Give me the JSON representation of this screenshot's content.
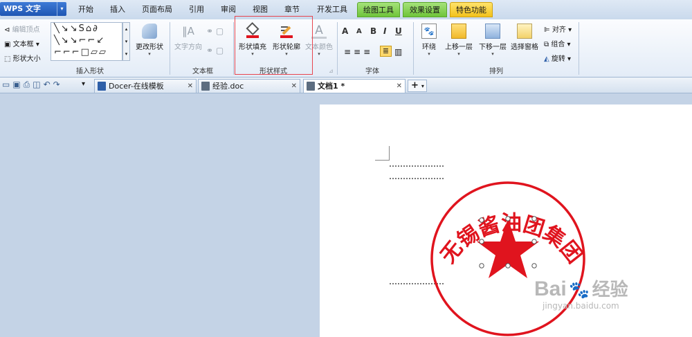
{
  "app": {
    "name": "WPS 文字"
  },
  "tabs": [
    {
      "label": "开始"
    },
    {
      "label": "插入"
    },
    {
      "label": "页面布局"
    },
    {
      "label": "引用"
    },
    {
      "label": "审阅"
    },
    {
      "label": "视图"
    },
    {
      "label": "章节"
    },
    {
      "label": "开发工具"
    },
    {
      "label": "绘图工具"
    },
    {
      "label": "效果设置"
    },
    {
      "label": "特色功能"
    }
  ],
  "ribbon": {
    "insert_shapes": {
      "edit_points": "编辑顶点",
      "textbox": "文本框",
      "shape_size": "形状大小",
      "change_shape": "更改形状",
      "group_label": "插入形状"
    },
    "textbox_group": {
      "text_direction": "文字方向",
      "group_label": "文本框"
    },
    "shape_style": {
      "fill": "形状填充",
      "outline": "形状轮廓",
      "text_color": "文本颜色",
      "group_label": "形状样式"
    },
    "font": {
      "group_label": "字体",
      "grow": "A",
      "shrink": "A",
      "bold": "B",
      "italic": "I",
      "underline": "U"
    },
    "arrange": {
      "wrap": "环绕",
      "bring_forward": "上移一层",
      "send_backward": "下移一层",
      "selection_pane": "选择窗格",
      "align": "对齐",
      "group": "组合",
      "rotate": "旋转",
      "group_label": "排列"
    }
  },
  "doc_tabs": [
    {
      "label": "Docer-在线模板"
    },
    {
      "label": "经验.doc"
    },
    {
      "label": "文档1 *"
    }
  ],
  "document": {
    "stamp_text": "无锡酱油团集团"
  },
  "watermark": {
    "brand": "Bai",
    "brand2": "经验",
    "url": "jingyan.baidu.com"
  },
  "colors": {
    "stamp_red": "#e0141e",
    "accent_blue": "#2e5fa8"
  }
}
